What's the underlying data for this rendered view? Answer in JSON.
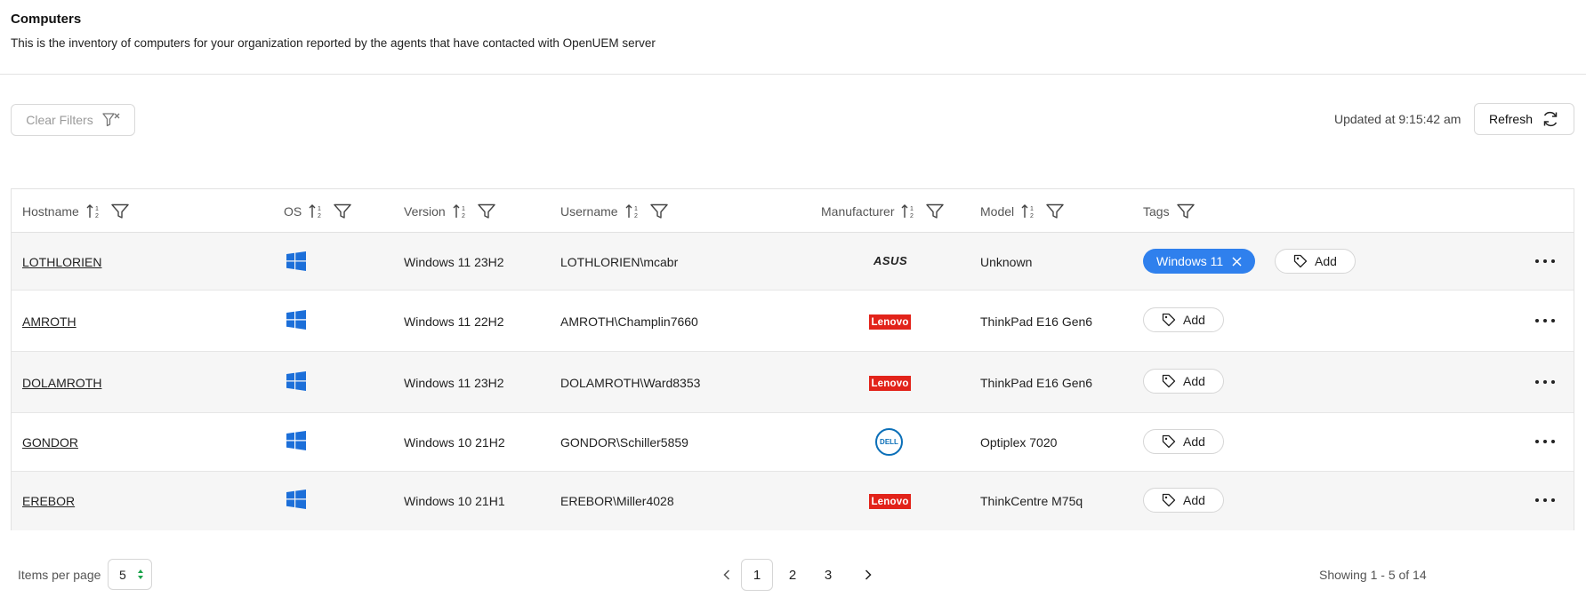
{
  "header": {
    "title": "Computers",
    "subtitle": "This is the inventory of computers for your organization reported by the agents that have contacted with OpenUEM server"
  },
  "toolbar": {
    "clear_filters_label": "Clear Filters",
    "updated_text": "Updated at 9:15:42 am",
    "refresh_label": "Refresh"
  },
  "table": {
    "columns": [
      "Hostname",
      "OS",
      "Version",
      "Username",
      "Manufacturer",
      "Model",
      "Tags"
    ],
    "rows": [
      {
        "hostname": "LOTHLORIEN",
        "os_icon": "windows-icon",
        "version": "Windows 11 23H2",
        "username": "LOTHLORIEN\\mcabr",
        "manufacturer": "ASUS",
        "model": "Unknown",
        "tags": [
          "Windows 11"
        ],
        "add_label": "Add"
      },
      {
        "hostname": "AMROTH",
        "os_icon": "windows-icon",
        "version": "Windows 11 22H2",
        "username": "AMROTH\\Champlin7660",
        "manufacturer": "Lenovo",
        "model": "ThinkPad E16 Gen6",
        "tags": [],
        "add_label": "Add"
      },
      {
        "hostname": "DOLAMROTH",
        "os_icon": "windows-icon",
        "version": "Windows 11 23H2",
        "username": "DOLAMROTH\\Ward8353",
        "manufacturer": "Lenovo",
        "model": "ThinkPad E16 Gen6",
        "tags": [],
        "add_label": "Add"
      },
      {
        "hostname": "GONDOR",
        "os_icon": "windows-icon",
        "version": "Windows 10 21H2",
        "username": "GONDOR\\Schiller5859",
        "manufacturer": "DELL",
        "model": "Optiplex 7020",
        "tags": [],
        "add_label": "Add"
      },
      {
        "hostname": "EREBOR",
        "os_icon": "windows-icon",
        "version": "Windows 10 21H1",
        "username": "EREBOR\\Miller4028",
        "manufacturer": "Lenovo",
        "model": "ThinkCentre M75q",
        "tags": [],
        "add_label": "Add"
      }
    ]
  },
  "footer": {
    "items_per_page_label": "Items per page",
    "items_per_page_value": "5",
    "pages": [
      "1",
      "2",
      "3"
    ],
    "current_page": "1",
    "showing_text": "Showing 1 - 5 of 14"
  },
  "colors": {
    "accent": "#2f80ed",
    "windows": "#1c6fd9",
    "lenovo": "#e2231a",
    "dell": "#0b6fb8"
  }
}
